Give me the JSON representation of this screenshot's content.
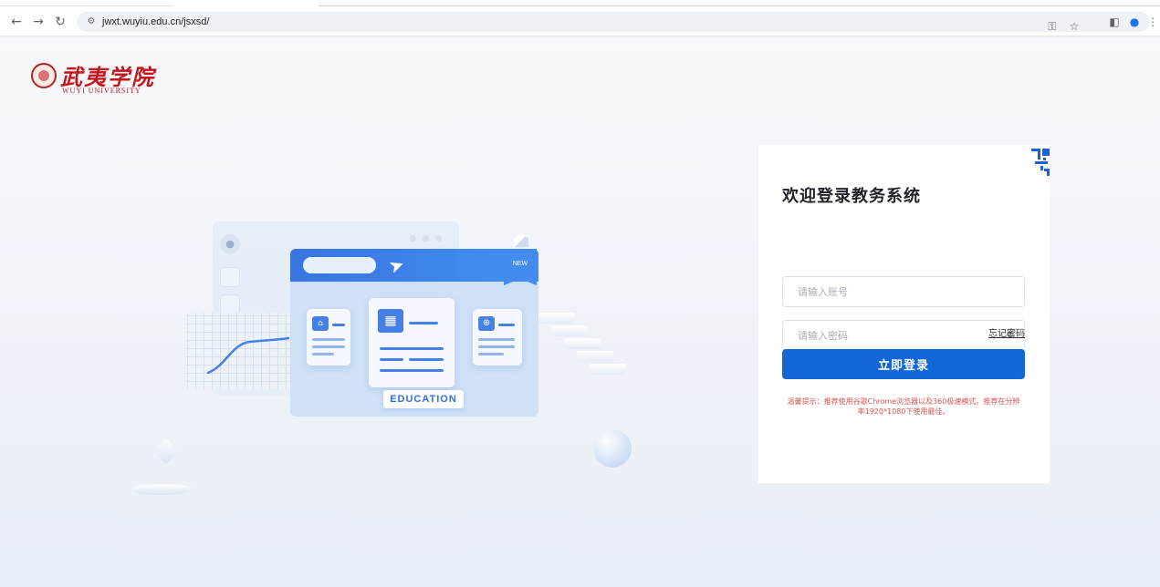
{
  "browser": {
    "url": "jwxt.wuyiu.edu.cn/jsxsd/",
    "icons": [
      "back-icon",
      "forward-icon",
      "reload-icon",
      "site-info-icon",
      "key-icon",
      "star-icon",
      "side-panel-icon",
      "profile-icon",
      "menu-icon"
    ]
  },
  "logo": {
    "name_cn": "武夷学院",
    "name_en": "WUYI UNIVERSITY"
  },
  "illustration": {
    "ribbon": "NEW",
    "badge": "EDUCATION"
  },
  "login": {
    "title": "欢迎登录教务系统",
    "account_placeholder": "请输入账号",
    "password_placeholder": "请输入密码",
    "forgot_label": "忘记密码",
    "submit_label": "立即登录",
    "tip": "温馨提示：推荐使用谷歌Chrome浏览器以及360极速模式。推荐在分辨率1920*1080下使用最佳。"
  },
  "colors": {
    "primary": "#1366d6",
    "brand_red": "#c4161c",
    "tip_red": "#d9534f"
  }
}
